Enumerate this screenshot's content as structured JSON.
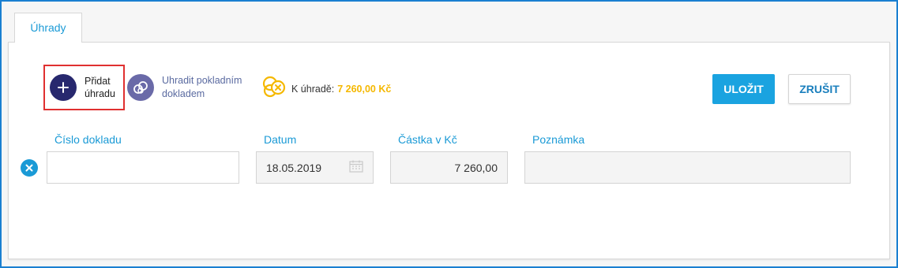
{
  "tabs": [
    {
      "label": "Úhrady",
      "active": true
    }
  ],
  "toolbar": {
    "add_line1": "Přidat",
    "add_line2": "úhradu",
    "pay_line1": "Uhradit pokladním",
    "pay_line2": "dokladem",
    "due_label": "K úhradě:",
    "due_value": "7 260,00 Kč",
    "save_label": "ULOŽIT",
    "cancel_label": "ZRUŠIT"
  },
  "columns": {
    "doc_number": "Číslo dokladu",
    "date": "Datum",
    "amount": "Částka v Kč",
    "note": "Poznámka"
  },
  "row": {
    "doc_number": "",
    "date": "18.05.2019",
    "amount": "7 260,00",
    "note": ""
  },
  "icons": {
    "add": "plus-icon",
    "pay": "cash-register-icon",
    "due": "coins-icon",
    "calendar": "calendar-icon",
    "remove": "close-icon"
  },
  "colors": {
    "accent": "#1a9ad6",
    "add_circle": "#27286e",
    "pay_circle": "#6a6aa8",
    "due_value": "#f5b800",
    "highlight_border": "#e03030"
  }
}
